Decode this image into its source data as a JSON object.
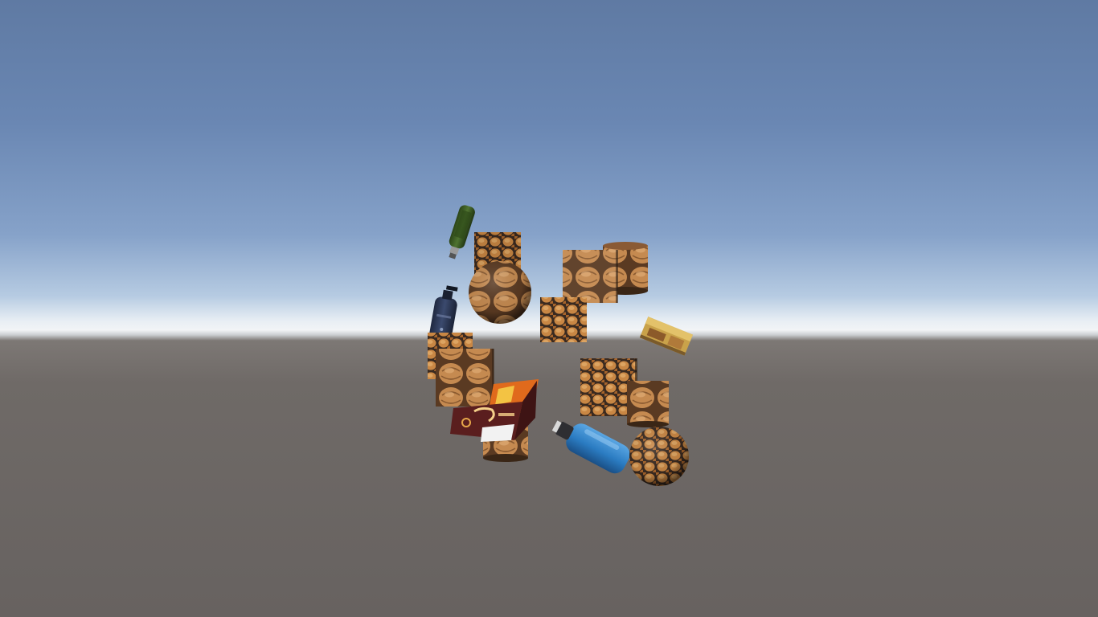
{
  "scene": {
    "sky_top": "#5f7aa3",
    "horizon": "#f2f4f6",
    "ground": "#6f6a67",
    "texture_palette": {
      "nut_light": "#d79a55",
      "nut_mid": "#b06f30",
      "nut_dark": "#2d2320",
      "shell": "#c89058"
    },
    "product_colors": {
      "green_bottle": "#3d5a23",
      "navy_bottle": "#2a3550",
      "blue_bottle": "#2c7fc4",
      "cracker_box": "#5a1e1e",
      "cracker_box_accent": "#e06a1c",
      "small_box": "#c9a24a"
    },
    "objects": [
      {
        "name": "green-bottle",
        "kind": "bottle"
      },
      {
        "name": "navy-bottle",
        "kind": "bottle"
      },
      {
        "name": "blue-bottle",
        "kind": "bottle"
      },
      {
        "name": "cracker-box",
        "kind": "box"
      },
      {
        "name": "small-gold-box",
        "kind": "box"
      },
      {
        "name": "nut-cube",
        "kind": "cube"
      },
      {
        "name": "nut-sphere",
        "kind": "sphere"
      },
      {
        "name": "nut-cylinder",
        "kind": "cylinder"
      }
    ]
  }
}
